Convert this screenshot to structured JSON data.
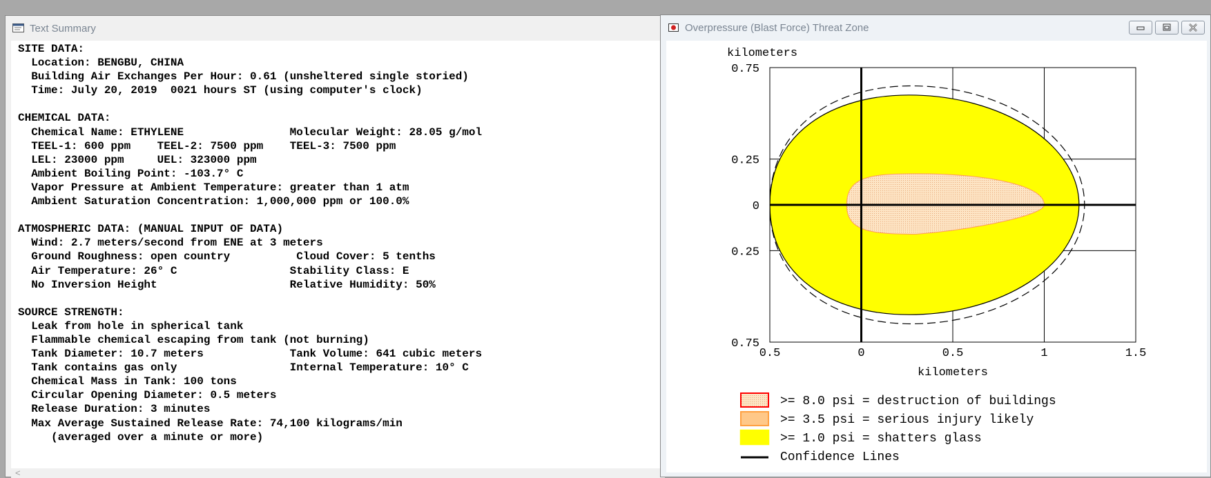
{
  "text_window": {
    "title": "Text Summary",
    "lines": [
      "SITE DATA:",
      "  Location: BENGBU, CHINA",
      "  Building Air Exchanges Per Hour: 0.61 (unsheltered single storied)",
      "  Time: July 20, 2019  0021 hours ST (using computer's clock)",
      "",
      "CHEMICAL DATA:",
      "  Chemical Name: ETHYLENE                Molecular Weight: 28.05 g/mol",
      "  TEEL-1: 600 ppm    TEEL-2: 7500 ppm    TEEL-3: 7500 ppm",
      "  LEL: 23000 ppm     UEL: 323000 ppm",
      "  Ambient Boiling Point: -103.7° C",
      "  Vapor Pressure at Ambient Temperature: greater than 1 atm",
      "  Ambient Saturation Concentration: 1,000,000 ppm or 100.0%",
      "",
      "ATMOSPHERIC DATA: (MANUAL INPUT OF DATA)",
      "  Wind: 2.7 meters/second from ENE at 3 meters",
      "  Ground Roughness: open country          Cloud Cover: 5 tenths",
      "  Air Temperature: 26° C                 Stability Class: E",
      "  No Inversion Height                    Relative Humidity: 50%",
      "",
      "SOURCE STRENGTH:",
      "  Leak from hole in spherical tank",
      "  Flammable chemical escaping from tank (not burning)",
      "  Tank Diameter: 10.7 meters             Tank Volume: 641 cubic meters",
      "  Tank contains gas only                 Internal Temperature: 10° C",
      "  Chemical Mass in Tank: 100 tons",
      "  Circular Opening Diameter: 0.5 meters",
      "  Release Duration: 3 minutes",
      "  Max Average Sustained Release Rate: 74,100 kilograms/min",
      "     (averaged over a minute or more)"
    ],
    "scroll_left": "<"
  },
  "threat_window": {
    "title": "Overpressure (Blast Force) Threat Zone",
    "legend": [
      {
        "label": ">= 8.0 psi = destruction of buildings",
        "color": "#ff0000"
      },
      {
        "label": ">= 3.5 psi = serious injury likely",
        "color": "#ffa040"
      },
      {
        "label": ">= 1.0 psi = shatters glass",
        "color": "#ffff00"
      },
      {
        "label": "Confidence Lines",
        "color": "#000000"
      }
    ]
  },
  "chart_data": {
    "type": "area",
    "ylabel": "kilometers",
    "xlabel": "kilometers",
    "xlim": [
      -0.5,
      1.5
    ],
    "ylim": [
      -0.75,
      0.75
    ],
    "x_ticks": [
      "0.5",
      "0",
      "0.5",
      "1",
      "1.5"
    ],
    "y_ticks": [
      "0.75",
      "0.25",
      "0",
      "0.25",
      "0.75"
    ],
    "x_tick_values": [
      -0.5,
      0,
      0.5,
      1,
      1.5
    ],
    "y_tick_values": [
      0.75,
      0.25,
      0,
      -0.25,
      -0.75
    ],
    "grid": true,
    "zones": [
      {
        "name": ">= 1.0 psi = shatters glass",
        "fill": "#ffff00",
        "stroke": "#000000",
        "x_min": -0.5,
        "x_max": 1.19,
        "y_max": 0.6,
        "y_min": -0.6
      },
      {
        "name": ">= 3.5 psi = serious injury likely",
        "fill": "#fde4c4",
        "stroke": "#ff9a5a",
        "x_min": -0.08,
        "x_max": 1.0,
        "y_max": 0.17,
        "y_min": -0.16
      },
      {
        "name": "Confidence Lines",
        "stroke": "#000000",
        "dashed": true,
        "x_min": -0.5,
        "x_max": 1.22,
        "y_max": 0.65,
        "y_min": -0.65
      }
    ]
  }
}
